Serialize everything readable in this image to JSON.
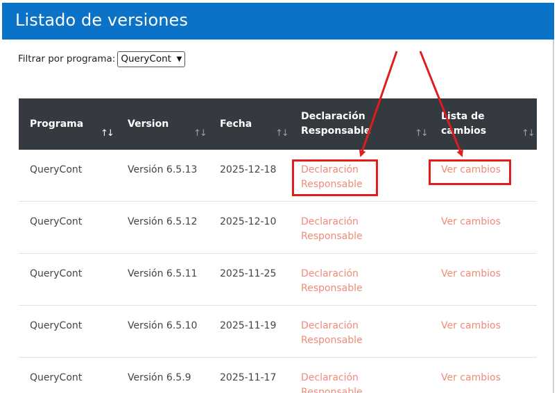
{
  "page": {
    "title": "Listado de versiones"
  },
  "filter": {
    "label": "Filtrar por programa:",
    "selected": "QueryCont"
  },
  "table": {
    "headers": [
      {
        "label": "Programa"
      },
      {
        "label": "Version"
      },
      {
        "label": "Fecha"
      },
      {
        "label": "Declaración Responsable"
      },
      {
        "label": "Lista de cambios"
      }
    ],
    "rows": [
      {
        "programa": "QueryCont",
        "version": "Versión 6.5.13",
        "fecha": "2025-12-18",
        "declaracion": "Declaración Responsable",
        "cambios": "Ver cambios"
      },
      {
        "programa": "QueryCont",
        "version": "Versión 6.5.12",
        "fecha": "2025-12-10",
        "declaracion": "Declaración Responsable",
        "cambios": "Ver cambios"
      },
      {
        "programa": "QueryCont",
        "version": "Versión 6.5.11",
        "fecha": "2025-11-25",
        "declaracion": "Declaración Responsable",
        "cambios": "Ver cambios"
      },
      {
        "programa": "QueryCont",
        "version": "Versión 6.5.10",
        "fecha": "2025-11-19",
        "declaracion": "Declaración Responsable",
        "cambios": "Ver cambios"
      },
      {
        "programa": "QueryCont",
        "version": "Versión 6.5.9",
        "fecha": "2025-11-17",
        "declaracion": "Declaración Responsable",
        "cambios": "Ver cambios"
      }
    ]
  },
  "colors": {
    "header_blue": "#0a73c7",
    "table_header": "#343a40",
    "link": "#f08a78",
    "annotation_red": "#e21b1b"
  }
}
